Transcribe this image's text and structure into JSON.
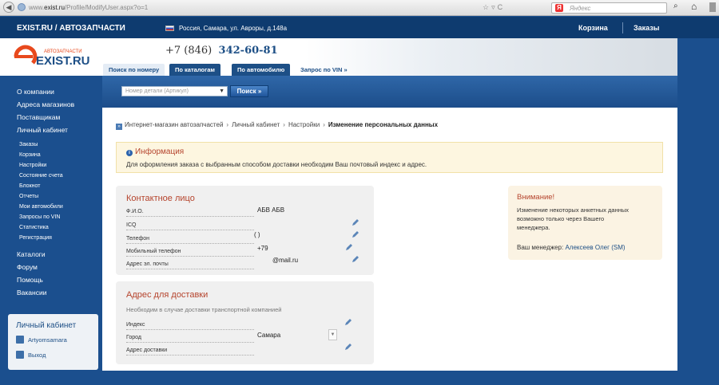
{
  "browser": {
    "url_prefix": "www.",
    "url_domain": "exist.ru",
    "url_path": "/Profile/ModifyUser.aspx?o=1",
    "search_placeholder": "Яндекс"
  },
  "topbar": {
    "brand": "EXIST.RU / АВТОЗАПЧАСТИ",
    "address": "Россия, Самара, ул. Авроры, д.148а",
    "cart": "Корзина",
    "orders": "Заказы"
  },
  "header": {
    "logo_tag": "АВТОЗАПЧАСТИ",
    "logo_text": "EXIST.RU",
    "phone_code": "+7 (846)",
    "phone_number": "342-60-81"
  },
  "tabs": [
    {
      "label": "Поиск по номеру"
    },
    {
      "label": "По каталогам"
    },
    {
      "label": "По автомобилю"
    },
    {
      "label": "Запрос по VIN »"
    }
  ],
  "search": {
    "placeholder": "Номер детали (Артикул)",
    "button": "Поиск »"
  },
  "sidebar": {
    "main": [
      {
        "label": "О компании"
      },
      {
        "label": "Адреса магазинов"
      },
      {
        "label": "Поставщикам"
      },
      {
        "label": "Личный кабинет"
      }
    ],
    "sub": [
      {
        "label": "Заказы"
      },
      {
        "label": "Корзина"
      },
      {
        "label": "Настройки"
      },
      {
        "label": "Состояние счета"
      },
      {
        "label": "Блокнот"
      },
      {
        "label": "Отчеты"
      },
      {
        "label": "Мои автомобили"
      },
      {
        "label": "Запросы по VIN"
      },
      {
        "label": "Статистика"
      },
      {
        "label": "Регистрация"
      }
    ],
    "bottom": [
      {
        "label": "Каталоги"
      },
      {
        "label": "Форум"
      },
      {
        "label": "Помощь"
      },
      {
        "label": "Вакансии"
      }
    ],
    "cabinet": {
      "title": "Личный кабинет",
      "user": "Artyomsamara",
      "logout": "Выход"
    }
  },
  "breadcrumb": {
    "items": [
      "Интернет-магазин автозапчастей",
      "Личный кабинет",
      "Настройки"
    ],
    "current": "Изменение персональных данных"
  },
  "info": {
    "title": "Информация",
    "text": "Для оформления заказа с выбранным способом доставки необходим Ваш почтовый индекс и адрес."
  },
  "contact": {
    "title": "Контактное лицо",
    "fields": [
      {
        "label": "Ф.И.О.",
        "value": "АБВ АБВ"
      },
      {
        "label": "ICQ",
        "value": ""
      },
      {
        "label": "Телефон",
        "value": "(        )"
      },
      {
        "label": "Мобильный телефон",
        "value": "+79"
      },
      {
        "label": "Адрес эл. почты",
        "value": "@mail.ru"
      }
    ]
  },
  "delivery": {
    "title": "Адрес для доставки",
    "note": "Необходим в случае доставки транспортной компанией",
    "fields": [
      {
        "label": "Индекс",
        "value": ""
      },
      {
        "label": "Город",
        "value": "Самара"
      },
      {
        "label": "Адрес доставки",
        "value": ""
      }
    ]
  },
  "attention": {
    "title": "Внимание!",
    "lines": [
      "Изменение некоторых анкетных данных",
      "возможно только через Вашего",
      "менеджера."
    ],
    "manager_label": "Ваш менеджер:",
    "manager_name": "Алексеев Олег (SM)"
  },
  "colors": {
    "primary": "#1b4f8e",
    "dark": "#0e3b6f",
    "accent": "#b5442d",
    "info_bg": "#fdf6e0"
  }
}
